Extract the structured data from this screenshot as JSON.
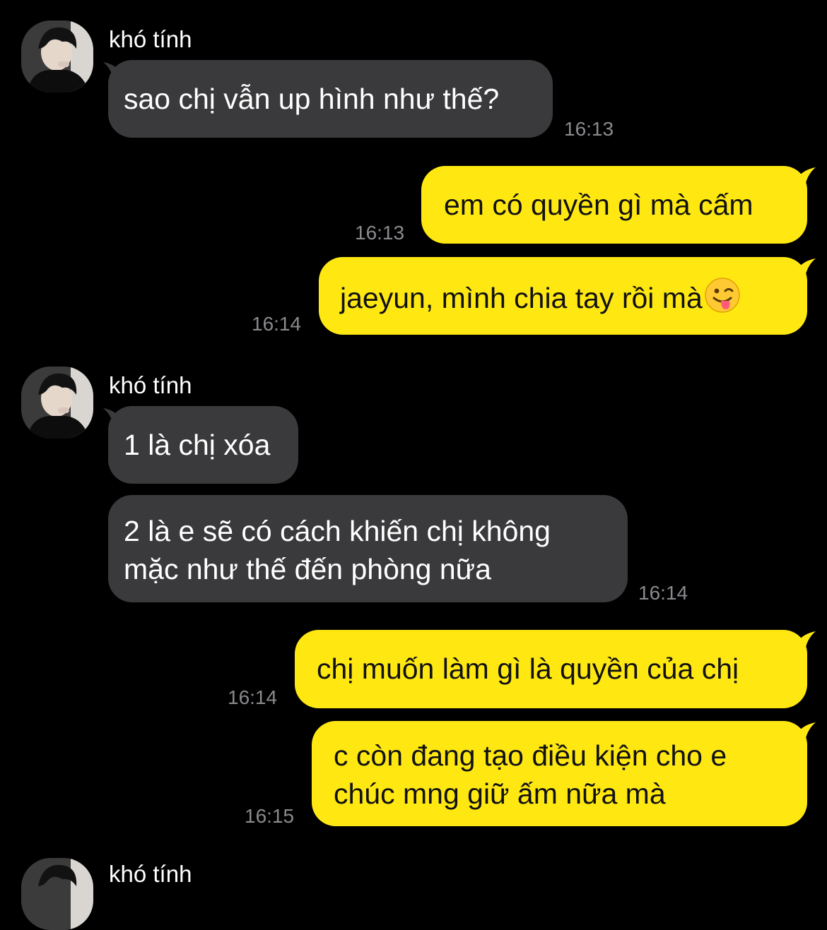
{
  "contact": {
    "name": "khó tính"
  },
  "messages": [
    {
      "side": "in",
      "lines": [
        "sao chị vẫn up hình như thế?"
      ],
      "time": "16:13"
    },
    {
      "side": "out",
      "lines": [
        "em có quyền gì mà cấm"
      ],
      "time": "16:13"
    },
    {
      "side": "out",
      "lines": [
        "jaeyun, mình chia tay rồi mà"
      ],
      "emoji": "winking-face-with-tongue",
      "time": "16:14"
    },
    {
      "side": "in",
      "lines": [
        "1 là chị xóa"
      ]
    },
    {
      "side": "in",
      "lines": [
        "2 là e sẽ có cách khiến chị không",
        "mặc như thế đến phòng nữa"
      ],
      "time": "16:14"
    },
    {
      "side": "out",
      "lines": [
        "chị muốn làm gì là quyền của chị"
      ],
      "time": "16:14"
    },
    {
      "side": "out",
      "lines": [
        "c còn đang tạo điều kiện cho e",
        "chúc mng giữ ấm nữa mà"
      ],
      "time": "16:15"
    }
  ],
  "colors": {
    "background": "#000000",
    "incoming_bubble": "#3a3a3c",
    "outgoing_bubble": "#ffe812",
    "timestamp": "#8a8a8e"
  }
}
